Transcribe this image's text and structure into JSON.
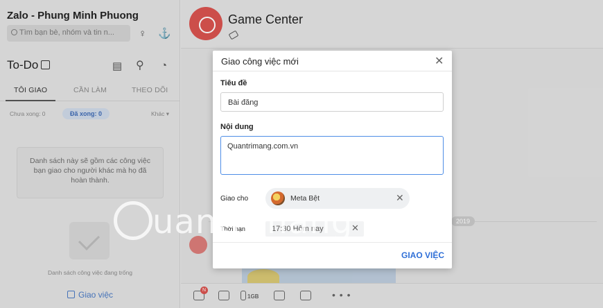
{
  "sidebar": {
    "account_name": "Zalo - Phung Minh Phuong",
    "search_placeholder": "Tìm bạn bè, nhóm và tin n...",
    "todo_title": "To-Do",
    "tabs": [
      {
        "label": "TÔI GIAO",
        "active": true
      },
      {
        "label": "CẦN LÀM",
        "active": false
      },
      {
        "label": "THEO DÕI",
        "active": false
      }
    ],
    "filters": {
      "pending": "Chưa xong: 0",
      "done": "Đã xong: 0",
      "other": "Khác"
    },
    "info_text": "Danh sách này sẽ gồm các công việc bạn giao cho người khác mà họ đã hoàn thành.",
    "empty_text": "Danh sách công việc đang trống",
    "assign_button": "Giao việc"
  },
  "chat": {
    "title": "Game Center",
    "date_badge": "2019",
    "toolbar_badge": "N",
    "file_label": "1GB",
    "more": "• • •"
  },
  "modal": {
    "title": "Giao công việc mới",
    "title_label": "Tiêu đề",
    "title_value": "Bài đăng",
    "content_label": "Nội dung",
    "content_value": "Quantrimang.com.vn",
    "assignee_label": "Giao cho",
    "assignee_name": "Meta Bệt",
    "deadline_label": "Thời hạn",
    "deadline_value": "17:30 Hôm nay",
    "submit_label": "GIAO VIỆC"
  },
  "watermark": "uantrimang",
  "colors": {
    "accent": "#2f6fd7",
    "brand_red": "#d9534f"
  }
}
